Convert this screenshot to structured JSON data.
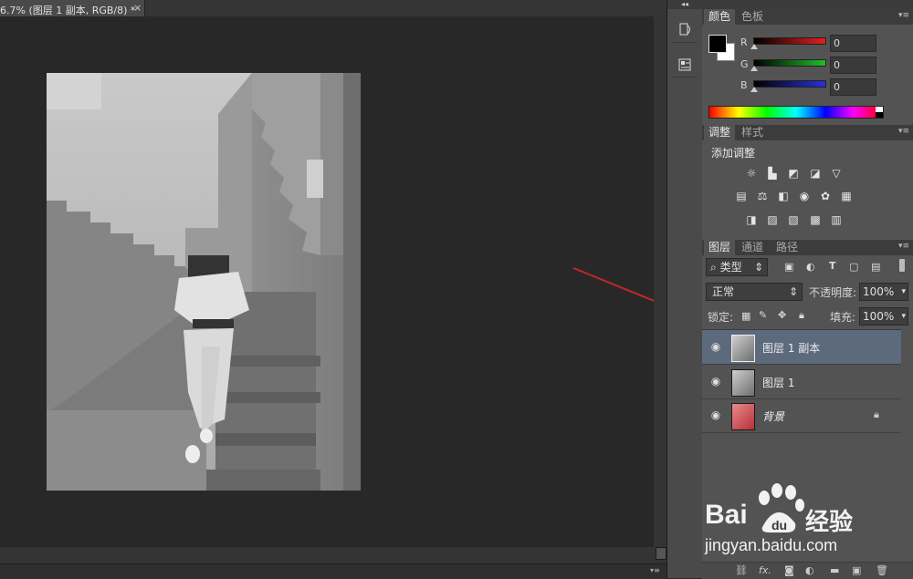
{
  "document": {
    "tab_title": "6.7% (图层 1 副本, RGB/8) *",
    "close_glyph": "×"
  },
  "panels": {
    "collapse_glyph": "◂◂",
    "color": {
      "tabs": [
        "颜色",
        "色板"
      ],
      "channels": [
        {
          "label": "R",
          "value": "0",
          "color": "#d81e1e"
        },
        {
          "label": "G",
          "value": "0",
          "color": "#1fbf2a"
        },
        {
          "label": "B",
          "value": "0",
          "color": "#2830d8"
        }
      ]
    },
    "adjustments": {
      "tabs": [
        "调整",
        "样式"
      ],
      "heading": "添加调整",
      "icons_row1": [
        "brightness-icon",
        "levels-icon",
        "curves-icon",
        "exposure-icon",
        "triangle-icon"
      ],
      "icons_row2": [
        "vibrance-icon",
        "balance-icon",
        "bw-icon",
        "camera-icon",
        "mixer-icon",
        "grid-icon"
      ],
      "icons_row3": [
        "invert-icon",
        "posterize-icon",
        "threshold-icon",
        "gradient-map-icon",
        "selective-color-icon"
      ]
    },
    "layers": {
      "tabs": [
        "图层",
        "通道",
        "路径"
      ],
      "filter_label": "类型",
      "blend_mode": "正常",
      "opacity_label": "不透明度:",
      "opacity_value": "100%",
      "lock_label": "锁定:",
      "fill_label": "填充:",
      "fill_value": "100%",
      "items": [
        {
          "name": "图层 1 副本",
          "selected": true
        },
        {
          "name": "图层 1",
          "selected": false
        },
        {
          "name": "背景",
          "selected": false
        }
      ]
    }
  },
  "watermark": {
    "brand_left": "Bai",
    "brand_right": "经验",
    "url": "jingyan.baidu.com"
  },
  "colors": {
    "accent_arrow": "#c0272d",
    "selected_layer": "#5d6a7e"
  }
}
